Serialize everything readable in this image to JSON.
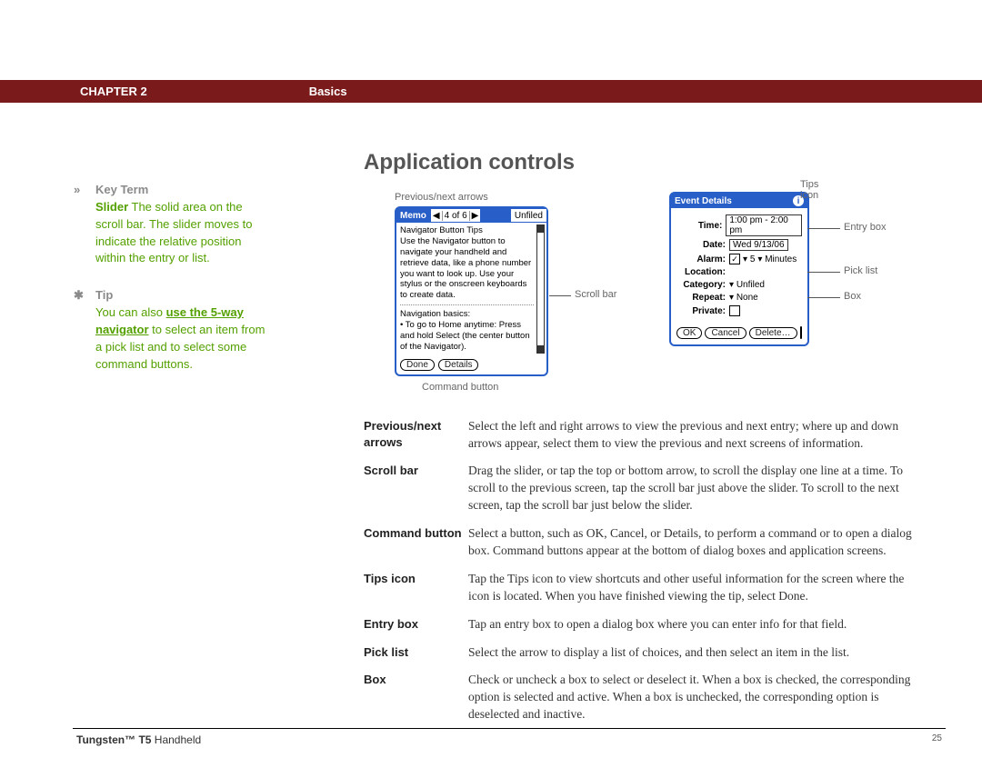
{
  "banner": {
    "chapter": "CHAPTER 2",
    "section": "Basics"
  },
  "sidebar": {
    "keyterm_hdr": "Key Term",
    "keyterm_bold": "Slider",
    "keyterm_body": "   The solid area on the scroll bar. The slider moves to indicate the relative position within the entry or list.",
    "tip_hdr": "Tip",
    "tip_pre": "You can also ",
    "tip_link": "use the 5-way navigator",
    "tip_post": " to select an item from a pick list and to select some command buttons."
  },
  "heading": "Application controls",
  "captions": {
    "prev_next": "Previous/next arrows",
    "tips_icon": "Tips icon",
    "scroll_bar": "Scroll bar",
    "cmd_btn": "Command button",
    "entry_box": "Entry box",
    "pick_list": "Pick list",
    "box": "Box"
  },
  "memo": {
    "title": "Memo",
    "nav_left": "◀",
    "nav_count": "4 of 6",
    "nav_right": "▶",
    "category": "Unfiled",
    "line1": "Navigator Button Tips",
    "line2": "Use the Navigator button to navigate your handheld and retrieve data, like a phone number you want to look up. Use your stylus or the onscreen keyboards to create data.",
    "line3": "Navigation basics:",
    "line4": "• To go to Home anytime: Press and hold Select (the center button of the Navigator).",
    "btn_done": "Done",
    "btn_details": "Details"
  },
  "event": {
    "title": "Event Details",
    "info": "i",
    "rows": {
      "time_lbl": "Time:",
      "time_val": "1:00 pm - 2:00 pm",
      "date_lbl": "Date:",
      "date_val": "Wed 9/13/06",
      "alarm_lbl": "Alarm:",
      "alarm_chk": "✓",
      "alarm_num": "5",
      "alarm_unit": "Minutes",
      "loc_lbl": "Location:",
      "cat_lbl": "Category:",
      "cat_val": "Unfiled",
      "rep_lbl": "Repeat:",
      "rep_val": "None",
      "priv_lbl": "Private:"
    },
    "btn_ok": "OK",
    "btn_cancel": "Cancel",
    "btn_delete": "Delete…"
  },
  "defs": [
    {
      "k": "Previous/next arrows",
      "v": "Select the left and right arrows to view the previous and next entry; where up and down arrows appear, select them to view the previous and next screens of information."
    },
    {
      "k": "Scroll bar",
      "v": "Drag the slider, or tap the top or bottom arrow, to scroll the display one line at a time. To scroll to the previous screen, tap the scroll bar just above the slider. To scroll to the next screen, tap the scroll bar just below the slider."
    },
    {
      "k": "Command button",
      "v": "Select a button, such as OK, Cancel, or Details, to perform a command or to open a dialog box. Command buttons appear at the bottom of dialog boxes and application screens."
    },
    {
      "k": "Tips icon",
      "v": "Tap the Tips icon to view shortcuts and other useful information for the screen where the icon is located. When you have finished viewing the tip, select Done."
    },
    {
      "k": "Entry box",
      "v": "Tap an entry box to open a dialog box where you can enter info for that field."
    },
    {
      "k": "Pick list",
      "v": "Select the arrow to display a list of choices, and then select an item in the list."
    },
    {
      "k": "Box",
      "v": "Check or uncheck a box to select or deselect it. When a box is checked, the corresponding option is selected and active. When a box is unchecked, the corresponding option is deselected and inactive."
    }
  ],
  "footer": {
    "product_bold": "Tungsten™ T5",
    "product_rest": " Handheld",
    "page": "25"
  }
}
